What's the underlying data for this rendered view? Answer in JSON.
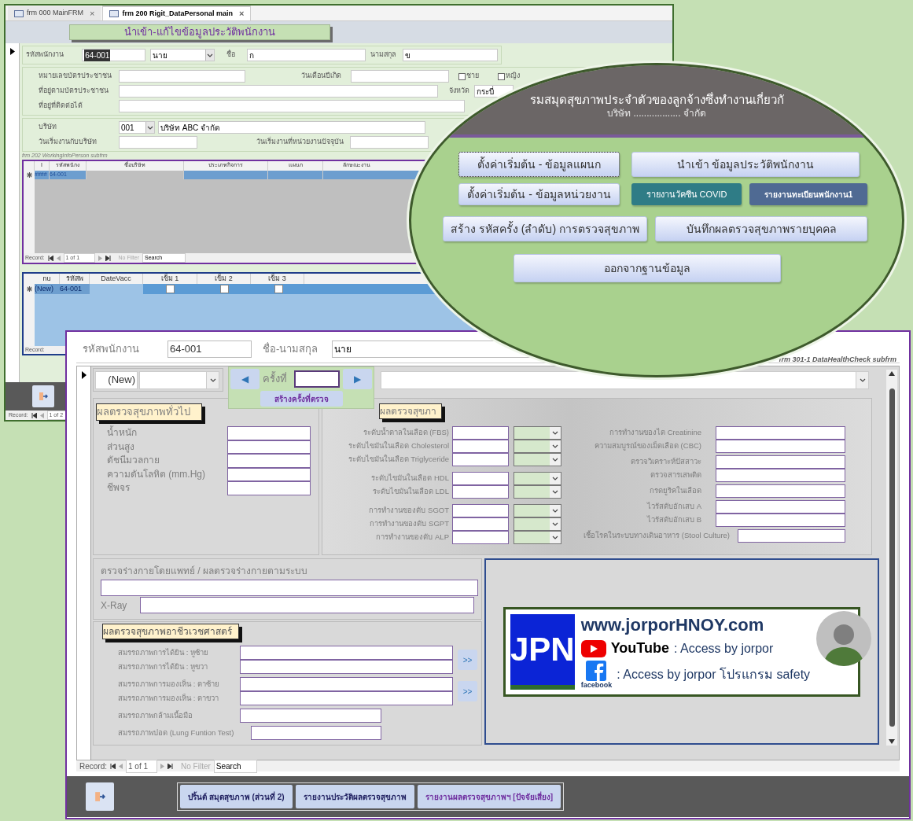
{
  "main_window": {
    "tabs": [
      {
        "label": "frm 000 MainFRM",
        "selected": false,
        "close": "×"
      },
      {
        "label": "frm 200 Rigit_DataPersonal main",
        "selected": true,
        "close": "×"
      }
    ],
    "form_title": "นำเข้า-แก้ไขข้อมูลประวัติพนักงาน",
    "employee_id": {
      "label": "รหัสพนักงาน",
      "value": "64-001"
    },
    "prefix": {
      "value": "นาย"
    },
    "first_name": {
      "label": "ชื่อ",
      "value": "ก"
    },
    "last_name": {
      "label": "นามสกุล",
      "value": "ข"
    },
    "id_card": {
      "label": "หมายเลขบัตรประชาชน"
    },
    "birth_date": {
      "label": "วันเดือนปีเกิด"
    },
    "gender_options": [
      {
        "label": "ชาย",
        "checked": false
      },
      {
        "label": "หญิง",
        "checked": false
      }
    ],
    "id_address": {
      "label": "ที่อยู่ตามบัตรประชาชน"
    },
    "province": {
      "label": "จังหวัด",
      "value": "กระบี่"
    },
    "contact_address": {
      "label": "ที่อยู่ที่ติดต่อได้"
    },
    "company": {
      "label": "บริษัท",
      "code": "001",
      "name": "บริษัท ABC จำกัด"
    },
    "start_company": {
      "label": "วันเริ่มงานกับบริษัท"
    },
    "start_unit": {
      "label": "วันเริ่มงานที่หน่วยงานปัจจุบัน"
    },
    "work_subform": {
      "caption": "frm 202 WorkingInfoPerson subfrm",
      "columns": [
        "I",
        "รหัสพนักง",
        "ชื่อบริษัท",
        "ประเภทกิจการ",
        "แผนก",
        "ลักษณะงาน"
      ],
      "rows": [
        [
          "####",
          "64-001"
        ]
      ],
      "record_nav": {
        "label": "Record:",
        "position": "1 of 1",
        "filter": "No Filter",
        "search": "Search"
      }
    },
    "vaccine_subform": {
      "columns": [
        "nu",
        "รหัสพ",
        "DateVacc",
        "เข็ม 1",
        "เข็ม 2",
        "เข็ม 3"
      ],
      "rows": [
        {
          "id": "(New)",
          "employee": "64-001",
          "doses": [
            false,
            false,
            false
          ]
        }
      ],
      "record_label": "Record:"
    },
    "record_nav": {
      "label": "Record:",
      "position": "1 of 2"
    }
  },
  "menu_overlay": {
    "title": "รมสมุดสุขภาพประจำตัวของลูกจ้างซึ่งทำงานเกี่ยวกั",
    "subtitle": "บริษัท .................. จำกัด",
    "buttons": [
      {
        "label": "ตั้งค่าเริ่มต้น - ข้อมูลแผนก",
        "kind": "focused"
      },
      {
        "label": "ตั้งค่าเริ่มต้น - ข้อมูลหน่วยงาน",
        "kind": "normal"
      },
      {
        "label": "นำเข้า ข้อมูลประวัติพนักงาน",
        "kind": "normal"
      },
      {
        "label": "รายงานวัคซีน COVID",
        "kind": "teal"
      },
      {
        "label": "รายงานทะเบียนพนักงาน1",
        "kind": "slate"
      },
      {
        "label": "สร้าง รหัสครั้ง (ลำดับ) การตรวจสุขภาพ",
        "kind": "normal"
      },
      {
        "label": "บันทึกผลตรวจสุขภาพรายบุคคล",
        "kind": "normal"
      },
      {
        "label": "ออกจากฐานข้อมูล",
        "kind": "normal"
      }
    ]
  },
  "health_form": {
    "employee_id": {
      "label": "รหัสพนักงาน",
      "value": "64-001"
    },
    "full_name": {
      "label": "ชื่อ-นามสกุล",
      "value": "นาย"
    },
    "subform_caption": "frm 301-1 DataHealthCheck subfrm",
    "record_id": "(New)",
    "visit": {
      "prev": "◀",
      "label": "ครั้งที่",
      "next": "▶",
      "create_button": "สร้างครั้งที่ตรวจ"
    },
    "general": {
      "heading": "ผลตรวจสุขภาพทั่วไป",
      "rows": [
        "น้ำหนัก",
        "ส่วนสูง",
        "ดัชนีมวลกาย",
        "ความดันโลหิต (mm.Hg)",
        "ชีพจร"
      ]
    },
    "lab": {
      "heading": "ผลตรวจสุขภา",
      "left_groups": [
        [
          "ระดับน้ำตาลในเลือด (FBS)",
          "ระดับไขมันในเลือด Cholesterol",
          "ระดับไขมันในเลือด Triglyceride"
        ],
        [
          "ระดับไขมันในเลือด HDL",
          "ระดับไขมันในเลือด LDL"
        ],
        [
          "การทำงานของตับ SGOT",
          "การทำงานของตับ SGPT",
          "การทำงานของตับ ALP"
        ]
      ],
      "right_groups": [
        [
          "การทำงานของไต Creatinine",
          "ความสมบูรณ์ของเม็ดเลือด (CBC)"
        ],
        [
          "ตรวจวิเคราะห์ปัสสาวะ",
          "ตรวจสารเสพติด"
        ],
        [
          "กรดยูริคในเลือด"
        ],
        [
          "ไวรัสตับอักเสบ A",
          "ไวรัสตับอักเสบ B"
        ]
      ],
      "stool_culture": "เชื้อโรคในระบบทางเดินอาหาร (Stool Culture)"
    },
    "physical": {
      "label": "ตรวจร่างกายโดยแพทย์ / ผลตรวจร่างกายตามระบบ",
      "xray_label": "X-Ray"
    },
    "occupational": {
      "heading": "ผลตรวจสุขภาพอาชีวเวชศาสตร์",
      "paired_groups": [
        {
          "rows": [
            "สมรรถภาพการได้ยิน : หูซ้าย",
            "สมรรถภาพการได้ยิน : หูขวา"
          ],
          "button": ">>"
        },
        {
          "rows": [
            "สมรรถภาพการมองเห็น : ตาซ้าย",
            "สมรรถภาพการมองเห็น : ตาขวา"
          ],
          "button": ">>"
        }
      ],
      "single_rows": [
        "สมรรถภาพกล้ามเนื้อมือ",
        "สมรรถภาพปอด (Lung Funtion Test)"
      ]
    },
    "banner": {
      "logo": "JPN",
      "site": "www.jorporHNOY.com",
      "youtube_label": "YouTube",
      "youtube_text": ": Access by jorpor",
      "facebook_caption": "facebook",
      "facebook_text": ": Access by jorpor โปรแกรม safety"
    },
    "record_nav": {
      "label": "Record:",
      "position": "1 of 1",
      "filter": "No Filter",
      "search": "Search"
    },
    "footer_buttons": [
      {
        "label": "ปริ้นต์ สมุดสุขภาพ (ส่วนที่ 2)",
        "kind": "normal"
      },
      {
        "label": "รายงานประวัติผลตรวจสุขภาพ",
        "kind": "normal"
      },
      {
        "label": "รายงานผลตรวจสุขภาพฯ [ปัจจัยเสี่ยง]",
        "kind": "accent"
      }
    ]
  }
}
